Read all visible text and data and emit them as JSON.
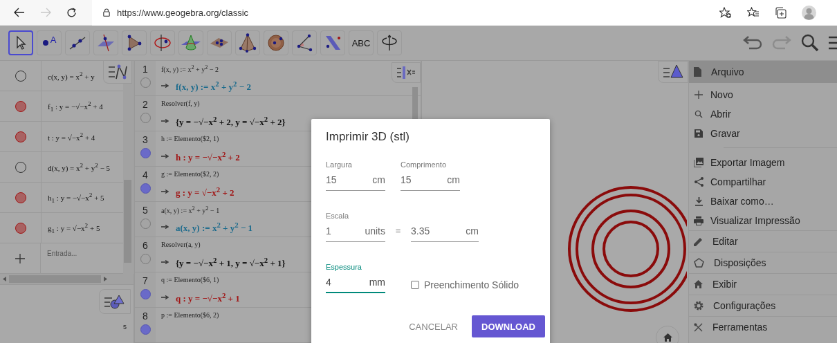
{
  "browser": {
    "url": "https://www.geogebra.org/classic",
    "forward_disabled": true
  },
  "toolbar": {
    "tools": [
      {
        "selected": true
      },
      {
        "label": "A",
        "selected": false
      },
      {
        "selected": false
      },
      {
        "selected": false
      },
      {
        "selected": false
      },
      {
        "selected": false
      },
      {
        "selected": false
      },
      {
        "selected": false
      },
      {
        "selected": false
      },
      {
        "selected": false
      },
      {
        "selected": false
      },
      {
        "selected": false
      },
      {
        "label": "ABC",
        "selected": false
      },
      {
        "selected": false
      }
    ],
    "redo_disabled": true
  },
  "algebra": {
    "rows": [
      {
        "formula": "c(x, y) = x$^{2}$ + y",
        "visible": false
      },
      {
        "formula": "f$_{1}$ : y = −√−x$^{2}$ + 4",
        "visible": true
      },
      {
        "formula": "t : y = √−x$^{2}$ + 4",
        "visible": true
      },
      {
        "formula": "d(x, y) = x$^{2}$ + y$^{2}$ − 5",
        "visible": false
      },
      {
        "formula": "h$_{1}$ : y = −√−x$^{2}$ + 5",
        "visible": true
      },
      {
        "formula": "g$_{1}$ : y = √−x$^{2}$ + 5",
        "visible": true
      }
    ],
    "input_placeholder": "Entrada...",
    "page": "5"
  },
  "cas": {
    "rows": [
      {
        "number": "1",
        "input": "f(x, y) := x$^{2}$ + y$^{2}$ − 2",
        "output": "f(x, y) := x$^{2}$ + y$^{2}$ − 2",
        "color": "#1a6a8c",
        "visible": false
      },
      {
        "number": "2",
        "input": "Resolver(f, y)",
        "output": "{y = −√−x$^{2}$ + 2, y = √−x$^{2}$ + 2}",
        "color": "#111111",
        "visible": false
      },
      {
        "number": "3",
        "input": "h := Elemento($2, 1)",
        "output": "h : y = −√−x$^{2}$ + 2",
        "color": "#a01414",
        "visible": true
      },
      {
        "number": "4",
        "input": "g := Elemento($2, 2)",
        "output": "g : y = √−x$^{2}$ + 2",
        "color": "#a01414",
        "visible": true
      },
      {
        "number": "5",
        "input": "a(x, y) := x$^{2}$ + y$^{2}$ − 1",
        "output": "a(x, y) := x$^{2}$ + y$^{2}$ − 1",
        "color": "#1a6a8c",
        "visible": false
      },
      {
        "number": "6",
        "input": "Resolver(a, y)",
        "output": "{y = −√−x$^{2}$ + 1, y = √−x$^{2}$ + 1}",
        "color": "#111111",
        "visible": false
      },
      {
        "number": "7",
        "input": "q := Elemento($6, 1)",
        "output": "q : y = −√−x$^{2}$ + 1",
        "color": "#a01414",
        "visible": true
      },
      {
        "number": "8",
        "input": "p := Elemento($6, 2)",
        "visible": true
      }
    ]
  },
  "menu": {
    "items": [
      {
        "label": "Arquivo",
        "expanded": true,
        "children": [
          {
            "kind": "item",
            "label": "Novo"
          },
          {
            "kind": "item",
            "label": "Abrir"
          },
          {
            "kind": "item",
            "label": "Gravar"
          },
          {
            "kind": "separator"
          },
          {
            "kind": "item",
            "label": "Exportar Imagem"
          },
          {
            "kind": "item",
            "label": "Compartilhar"
          },
          {
            "kind": "item",
            "label": "Baixar como…"
          },
          {
            "kind": "item",
            "label": "Visualizar Impressão"
          }
        ]
      },
      {
        "label": "Editar",
        "expanded": false
      },
      {
        "label": "Disposições",
        "expanded": false
      },
      {
        "label": "Exibir",
        "expanded": false
      },
      {
        "label": "Configurações",
        "expanded": false
      },
      {
        "label": "Ferramentas",
        "expanded": false
      }
    ]
  },
  "dialog": {
    "title": "Imprimir 3D (stl)",
    "width": {
      "label": "Largura",
      "value": "15",
      "unit": "cm",
      "focused": false
    },
    "length": {
      "label": "Comprimento",
      "value": "15",
      "unit": "cm",
      "focused": false
    },
    "scale_label": "Escala",
    "scale_from": {
      "value": "1",
      "unit": "units",
      "focused": false
    },
    "equals": "=",
    "scale_to": {
      "value": "3.35",
      "unit": "cm",
      "focused": false
    },
    "thickness": {
      "label": "Espessura",
      "value": "4",
      "unit": "mm",
      "focused": true
    },
    "solid_fill": {
      "label": "Preenchimento Sólido",
      "checked": false
    },
    "buttons": [
      {
        "kind": "text",
        "label": "CANCELAR"
      },
      {
        "kind": "primary",
        "label": "DOWNLOAD"
      }
    ]
  }
}
